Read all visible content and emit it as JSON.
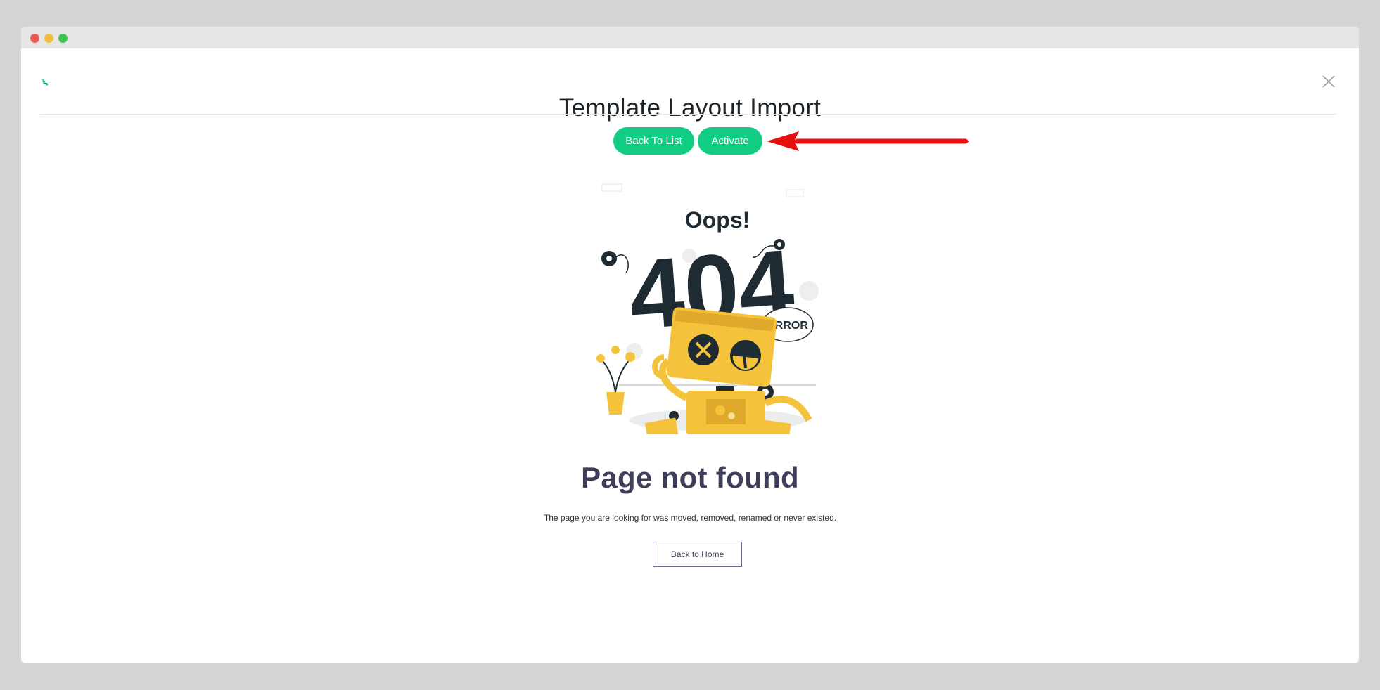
{
  "window": {
    "controls": [
      "close",
      "minimize",
      "maximize"
    ]
  },
  "modal": {
    "title": "Template Layout Import",
    "logo_icon": "leaf-logo-icon",
    "close_icon": "close-icon"
  },
  "toolbar": {
    "back_label": "Back To List",
    "activate_label": "Activate",
    "accent_color": "#11cc83"
  },
  "annotation": {
    "arrow_icon": "red-arrow-icon",
    "color": "#e8100f"
  },
  "error_illustration": {
    "oops": "Oops!",
    "code": "404",
    "bubble": "ERROR"
  },
  "error_page": {
    "heading": "Page not found",
    "message": "The page you are looking for was moved, removed, renamed or never existed.",
    "home_label": "Back to Home"
  }
}
